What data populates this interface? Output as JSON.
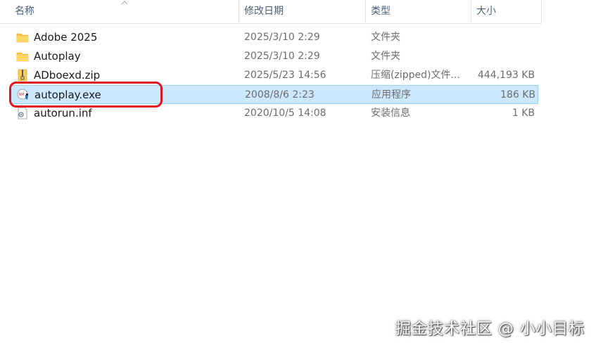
{
  "columns": {
    "name": "名称",
    "date": "修改日期",
    "type": "类型",
    "size": "大小"
  },
  "files": [
    {
      "name": "Adobe 2025",
      "date": "2025/3/10 2:29",
      "type": "文件夹",
      "size": "",
      "icon": "folder-icon"
    },
    {
      "name": "Autoplay",
      "date": "2025/3/10 2:29",
      "type": "文件夹",
      "size": "",
      "icon": "folder-icon"
    },
    {
      "name": "ADboexd.zip",
      "date": "2025/5/23 14:56",
      "type": "压缩(zipped)文件...",
      "size": "444,193 KB",
      "icon": "zip-icon"
    },
    {
      "name": "autoplay.exe",
      "date": "2008/8/6 2:23",
      "type": "应用程序",
      "size": "186 KB",
      "icon": "exe-icon",
      "selected": true
    },
    {
      "name": "autorun.inf",
      "date": "2020/10/5 14:08",
      "type": "安装信息",
      "size": "1 KB",
      "icon": "inf-icon"
    }
  ],
  "watermark": "掘金技术社区 @ 小小目标",
  "colors": {
    "selection_bg": "#cce8ff",
    "selection_border": "#99d1ff",
    "highlight_ring": "#e0151c",
    "folder": "#f3c64a"
  }
}
